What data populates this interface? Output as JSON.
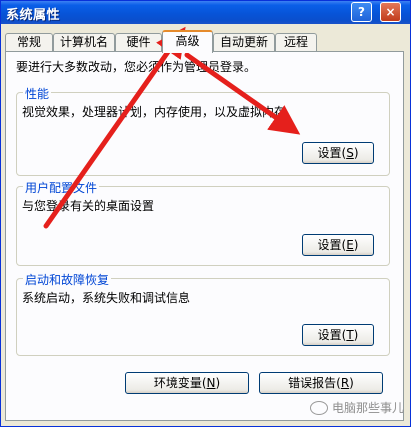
{
  "window": {
    "title": "系统属性",
    "help_button": "?",
    "close_button": "×"
  },
  "tabs": [
    {
      "label": "常规",
      "active": false
    },
    {
      "label": "计算机名",
      "active": false
    },
    {
      "label": "硬件",
      "active": false
    },
    {
      "label": "高级",
      "active": true
    },
    {
      "label": "自动更新",
      "active": false
    },
    {
      "label": "远程",
      "active": false
    }
  ],
  "advanced": {
    "intro": "要进行大多数改动，您必须作为管理员登录。",
    "performance": {
      "title": "性能",
      "description": "视觉效果，处理器计划，内存使用，以及虚拟内存",
      "button_text": "设置",
      "button_key": "S"
    },
    "user_profiles": {
      "title": "用户配置文件",
      "description": "与您登录有关的桌面设置",
      "button_text": "设置",
      "button_key": "E"
    },
    "startup_recovery": {
      "title": "启动和故障恢复",
      "description": "系统启动，系统失败和调试信息",
      "button_text": "设置",
      "button_key": "T"
    },
    "env_button_text": "环境变量",
    "env_button_key": "N",
    "error_button_text": "错误报告",
    "error_button_key": "R"
  },
  "watermark": "电脑那些事儿",
  "colors": {
    "titlebar": "#0a5fe8",
    "group_title": "#0046d5",
    "arrow": "#e5201c",
    "active_tab_accent": "#e68b2c"
  }
}
